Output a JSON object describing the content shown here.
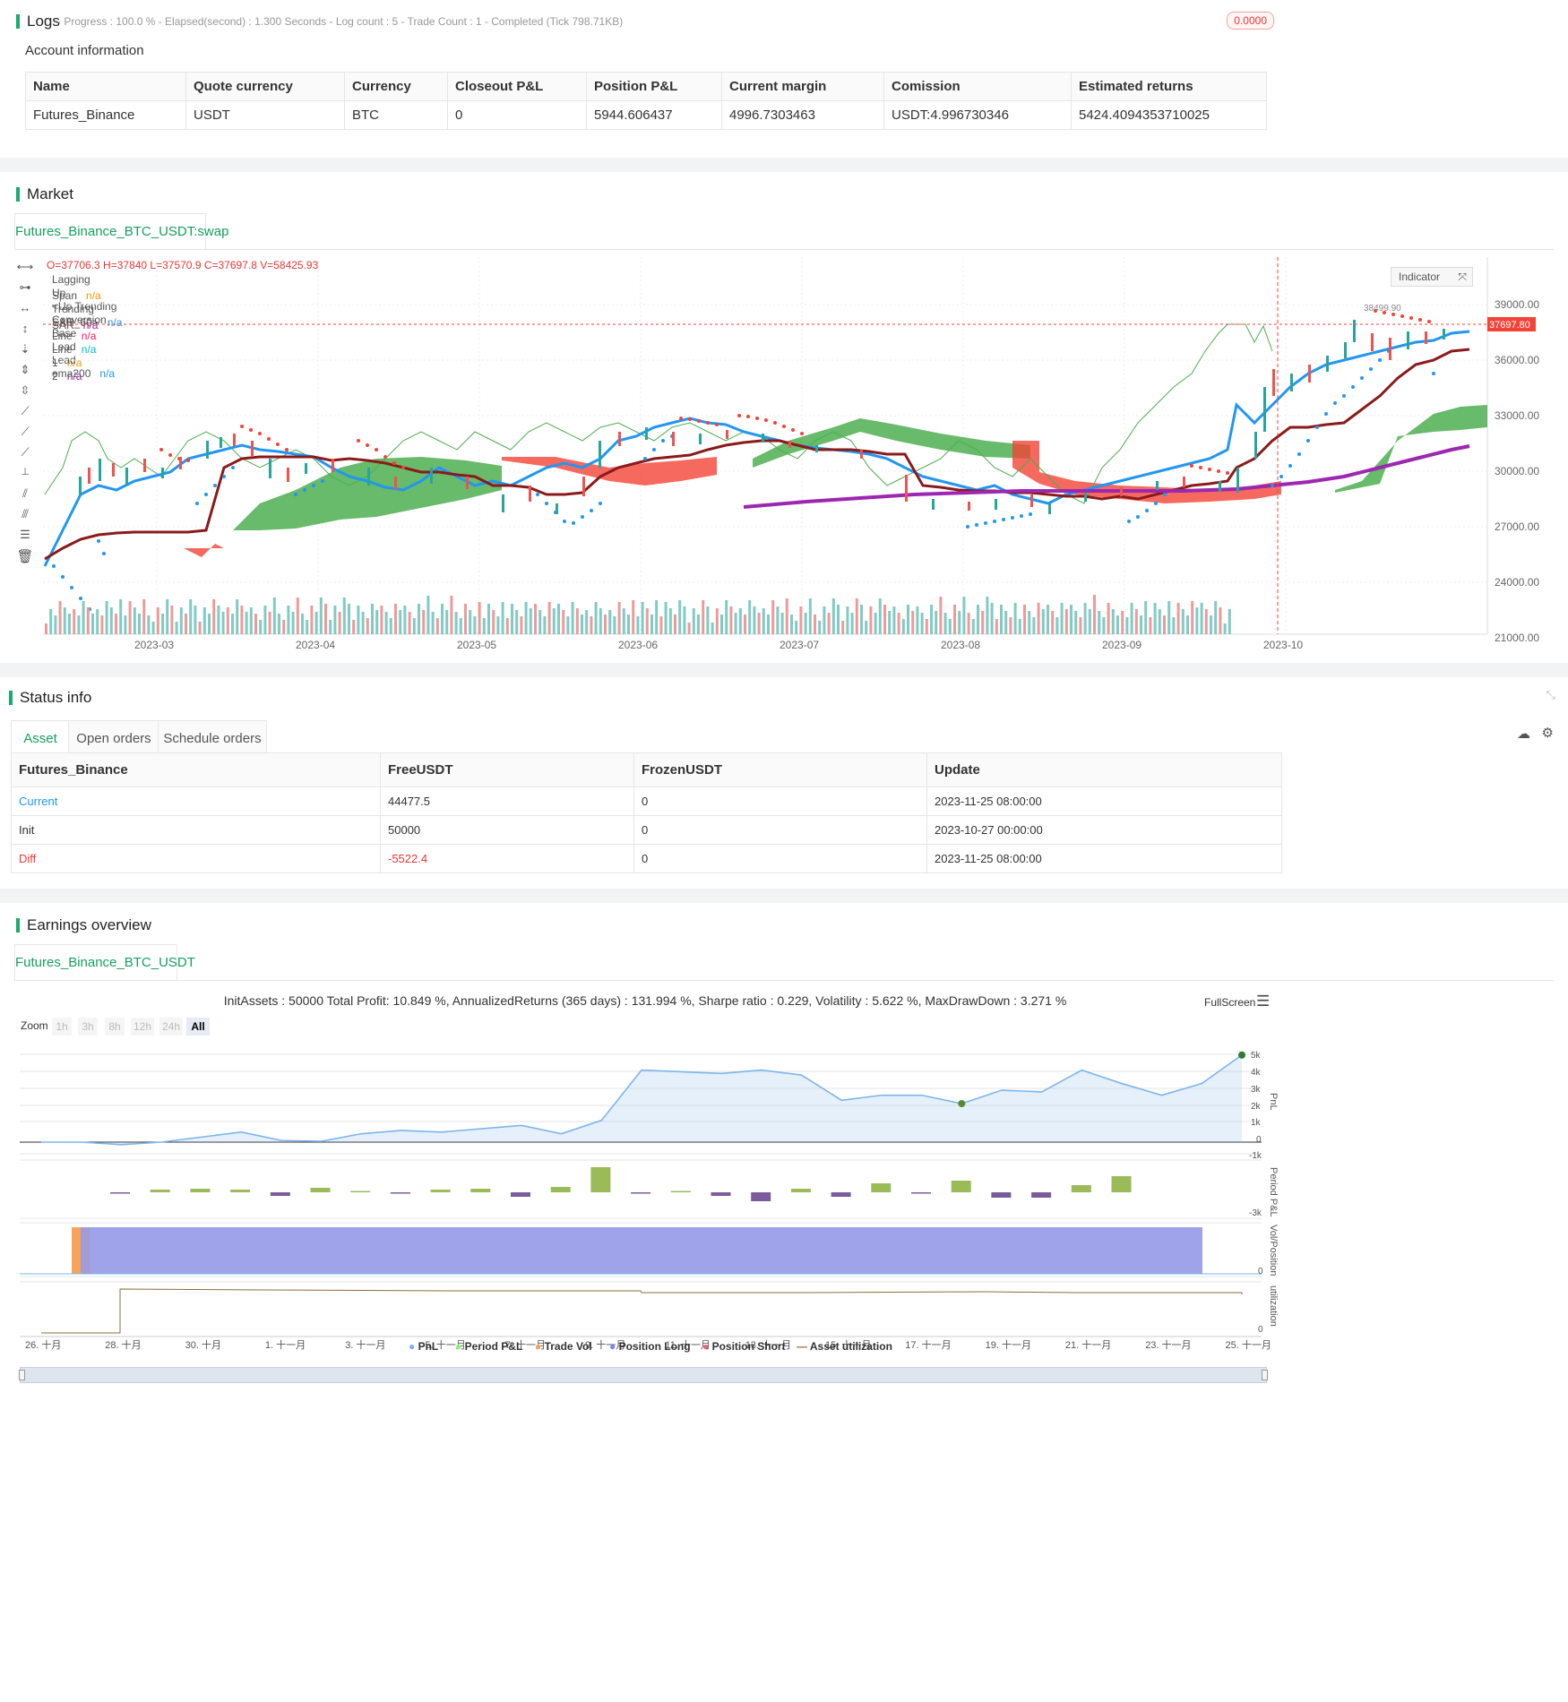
{
  "logs": {
    "title": "Logs",
    "status": "- Progress : 100.0 % - Elapsed(second) : 1.300  Seconds - Log count : 5 - Trade Count : 1 - Completed (Tick 798.71KB)",
    "badge": "0.0000",
    "account_title": "Account information",
    "headers": [
      "Name",
      "Quote currency",
      "Currency",
      "Closeout P&L",
      "Position P&L",
      "Current margin",
      "Comission",
      "Estimated returns"
    ],
    "row": [
      "Futures_Binance",
      "USDT",
      "BTC",
      "0",
      "5944.606437",
      "4996.7303463",
      "USDT:4.996730346",
      "5424.4094353710025"
    ]
  },
  "market": {
    "title": "Market",
    "tab": "Futures_Binance_BTC_USDT:swap",
    "ohlc": "O=37706.3 H=37840 L=37570.9 C=37697.8 V=58425.93",
    "indicator_btn": "Indicator",
    "legend": [
      {
        "name": "Lagging Span",
        "value": "n/a",
        "color": "#ff9800"
      },
      {
        "name": "Up Trending SAR",
        "value": "n/a",
        "color": "#9c27b0"
      },
      {
        "name": "<Up Trending SAR_60>",
        "value": "n/a",
        "color": "#2196f3"
      },
      {
        "name": "Conversion Line",
        "value": "n/a",
        "color": "#e91e63"
      },
      {
        "name": "Base Line",
        "value": "n/a",
        "color": "#00bcd4"
      },
      {
        "name": "Lead 1",
        "value": "n/a",
        "color": "#ff9800"
      },
      {
        "name": "Lead 2",
        "value": "n/a",
        "color": "#9c27b0"
      },
      {
        "name": "ema200",
        "value": "n/a",
        "color": "#2196f3"
      }
    ],
    "price_ticks": [
      "39000.00",
      "36000.00",
      "33000.00",
      "30000.00",
      "27000.00",
      "24000.00",
      "21000.00"
    ],
    "last_price": "37697.80",
    "high_label": "38499.90",
    "date_ticks": [
      "2023-03",
      "2023-04",
      "2023-05",
      "2023-06",
      "2023-07",
      "2023-08",
      "2023-09",
      "2023-10"
    ]
  },
  "status": {
    "title": "Status info",
    "tabs": [
      "Asset",
      "Open orders",
      "Schedule orders"
    ],
    "headers": [
      "Futures_Binance",
      "FreeUSDT",
      "FrozenUSDT",
      "Update"
    ],
    "rows": [
      [
        "Current",
        "44477.5",
        "0",
        "2023-11-25 08:00:00"
      ],
      [
        "Init",
        "50000",
        "0",
        "2023-10-27 00:00:00"
      ],
      [
        "Diff",
        "-5522.4",
        "0",
        "2023-11-25 08:00:00"
      ]
    ]
  },
  "earnings": {
    "title": "Earnings overview",
    "tab": "Futures_Binance_BTC_USDT",
    "summary": "InitAssets : 50000 Total Profit: 10.849 %, AnnualizedReturns (365 days) : 131.994 %, Sharpe ratio : 0.229, Volatility : 5.622 %, MaxDrawDown : 3.271 %",
    "fullscreen": "FullScreen",
    "zoom_label": "Zoom",
    "zoom_buttons": [
      "1h",
      "3h",
      "8h",
      "12h",
      "24h",
      "All"
    ],
    "pnl_ticks": [
      "5k",
      "4k",
      "3k",
      "2k",
      "1k",
      "0",
      "-1k"
    ],
    "period_tick": "-3k",
    "axis_titles": [
      "PnL",
      "Period P&L",
      "Vol/Position",
      "utilization"
    ],
    "vol_tick": "0",
    "util_tick": "0",
    "date_ticks": [
      "26. 十月",
      "28. 十月",
      "30. 十月",
      "1. 十一月",
      "3. 十一月",
      "5. 十一月",
      "7. 十一月",
      "9. 十一月",
      "11. 十一月",
      "13. 十一月",
      "15. 十一月",
      "17. 十一月",
      "19. 十一月",
      "21. 十一月",
      "23. 十一月",
      "25. 十一月"
    ],
    "legend": [
      {
        "name": "PnL",
        "color": "#7cb5ec"
      },
      {
        "name": "Period P&L",
        "color": "#90ed7d"
      },
      {
        "name": "Trade Vol",
        "color": "#f7a35c"
      },
      {
        "name": "Position Long",
        "color": "#8085e9"
      },
      {
        "name": "Position Short",
        "color": "#f15c80"
      },
      {
        "name": "Asset utilization",
        "color": "#8d6e3a"
      }
    ]
  },
  "chart_data": [
    {
      "type": "line",
      "title": "",
      "series": [
        {
          "name": "PnL",
          "values": [
            0,
            0,
            -150,
            0,
            300,
            600,
            100,
            50,
            500,
            700,
            600,
            800,
            1000,
            500,
            1300,
            4300,
            4200,
            4100,
            4300,
            4000,
            2500,
            2800,
            2800,
            2300,
            3100,
            3000,
            4300,
            3500,
            2800,
            3500,
            5200
          ]
        }
      ],
      "ylim": [
        -1000,
        5500
      ]
    },
    {
      "type": "bar",
      "series": [
        {
          "name": "Period P&L",
          "values": [
            -50,
            150,
            200,
            150,
            -200,
            250,
            60,
            -40,
            150,
            200,
            -250,
            300,
            1400,
            -40,
            60,
            -200,
            -500,
            200,
            -250,
            500,
            -40,
            650,
            -300,
            -300,
            400,
            900
          ]
        }
      ]
    }
  ]
}
